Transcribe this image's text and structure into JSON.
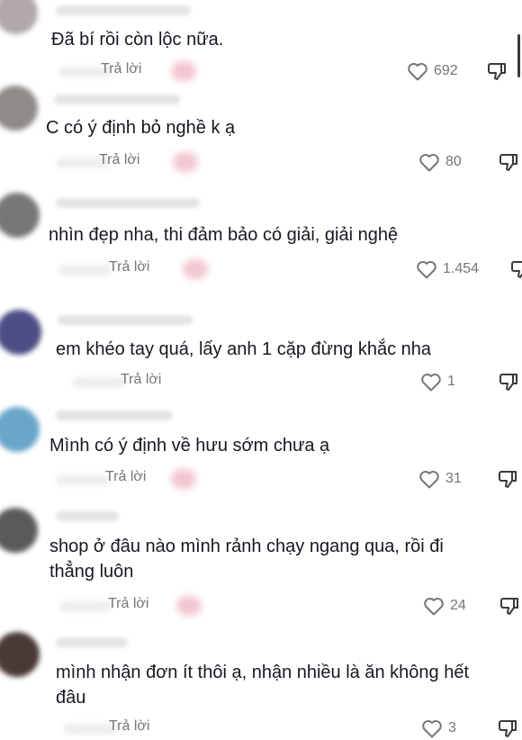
{
  "reply_label": "Trả lời",
  "comments": [
    {
      "text": "Đã bí rồi còn lộc nữa.",
      "likes": "692"
    },
    {
      "text": "C có ý định bỏ nghề k ạ",
      "likes": "80"
    },
    {
      "text": "nhìn đẹp nha, thi đảm bảo có giải, giải nghệ",
      "likes": "1.454"
    },
    {
      "text": "em khéo tay quá, lấy anh 1 cặp đừng khắc nha",
      "likes": "1"
    },
    {
      "text": "Mình có ý định về hưu sớm chưa ạ",
      "likes": "31"
    },
    {
      "text_line1": "shop ở đâu nào mình rảnh chạy ngang qua, rồi đi",
      "text_line2": "thẳng luôn",
      "likes": "24"
    },
    {
      "text_line1": "mình nhận đơn ít thôi ạ, nhận nhiều là ăn không hết",
      "text_line2": "đâu",
      "likes": "3"
    }
  ],
  "icons": {
    "like": "heart-outline-icon",
    "dislike": "thumbs-down-outline-icon"
  },
  "colors": {
    "text": "#161823",
    "secondary": "#75767a"
  }
}
